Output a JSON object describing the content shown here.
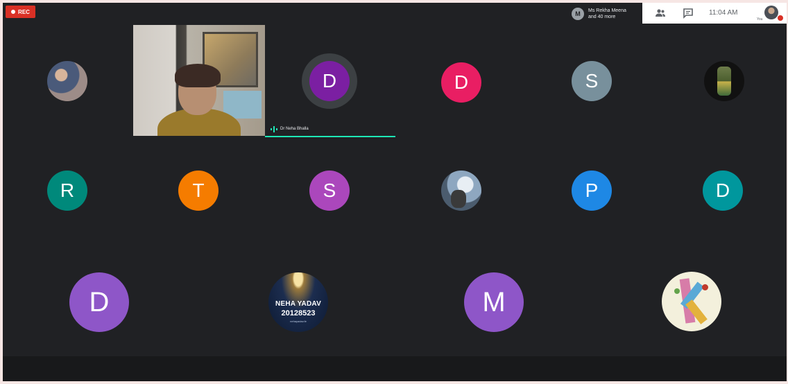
{
  "topbar": {
    "rec_label": "REC",
    "presenter_initial": "M",
    "presenter_line1": "Ms Rekha Meena",
    "presenter_line2": "and 40 more",
    "people_icon": "people-icon",
    "chat_icon": "chat-icon",
    "clock": "11:04 AM",
    "you_label": "You"
  },
  "speaker": {
    "name": "Dr Neha Bhalla"
  },
  "participants": {
    "row1": [
      {
        "type": "photo"
      },
      {
        "type": "video"
      },
      {
        "initial": "D",
        "color": "#7b1fa2"
      },
      {
        "initial": "D",
        "color": "#e91e63"
      },
      {
        "initial": "S",
        "color": "#78909c"
      },
      {
        "type": "photo"
      }
    ],
    "row2": [
      {
        "initial": "R",
        "color": "#00897b"
      },
      {
        "initial": "T",
        "color": "#f57c00"
      },
      {
        "initial": "S",
        "color": "#ab47bc"
      },
      {
        "type": "photo"
      },
      {
        "initial": "P",
        "color": "#1e88e5"
      },
      {
        "initial": "D",
        "color": "#00979d"
      }
    ],
    "row3": [
      {
        "initial": "D",
        "color": "#8e56c8"
      },
      {
        "type": "photo",
        "line1": "NEHA YADAV",
        "line2": "20128523",
        "line3": "nehayadav.fe"
      },
      {
        "initial": "M",
        "color": "#8e56c8"
      },
      {
        "type": "photo"
      }
    ]
  }
}
